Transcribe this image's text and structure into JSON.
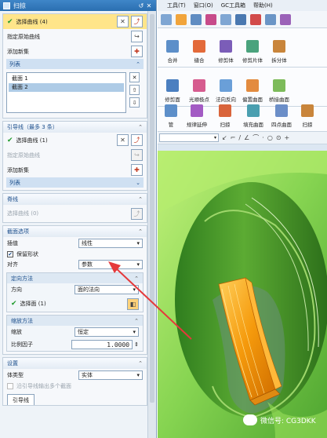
{
  "dialog": {
    "title": "扫掠",
    "section_curves": {
      "select_curve": "选择曲线 (4)",
      "origin_curve": "指定原始曲线",
      "add_new_set": "添加新集",
      "list_label": "列表",
      "list_items": [
        "截面 1",
        "截面 2"
      ]
    },
    "guides": {
      "title": "引导线（最多 3 条）",
      "select_curve": "选择曲线 (1)",
      "origin_curve": "指定原始曲线",
      "add_new_set": "添加新集",
      "list_label": "列表"
    },
    "spine": {
      "title": "脊线",
      "select_curve": "选择曲线 (0)"
    },
    "section_options": {
      "title": "截面选项",
      "interp_label": "插值",
      "interp_value": "线性",
      "preserve_shape": "保留形状",
      "align_label": "对齐",
      "align_value": "参数",
      "orientation": {
        "title": "定向方法",
        "direction_label": "方向",
        "direction_value": "面的法向",
        "select_face": "选择面 (1)"
      },
      "scaling": {
        "title": "缩放方法",
        "scale_label": "缩放",
        "scale_value": "恒定",
        "ratio_label": "比例因子",
        "ratio_value": "1.0000"
      }
    },
    "settings": {
      "title": "设置",
      "body_type_label": "体类型",
      "body_type_value": "实体",
      "guide_output_label": "沿引导线输出多个截面",
      "tab_label": "引导线"
    }
  },
  "app": {
    "menu": [
      "工具(T)",
      "窗口(O)",
      "GC工具箱",
      "帮助(H)"
    ],
    "ribbon_row1": [
      "合并",
      "缝合",
      "修剪体",
      "修剪片体",
      "拆分体"
    ],
    "ribbon_row2": [
      "修剪面",
      "光顺极点",
      "法向反向",
      "偏置曲面",
      "桥接曲面"
    ],
    "ribbon_row3": [
      "管",
      "规律延伸",
      "扫掠",
      "填充曲面",
      "四点曲面",
      "扫掠"
    ]
  },
  "watermark": "微信号: CG3DKK",
  "colors": {
    "title_bar": "#2b6fb1",
    "selected_row": "#ffe58a",
    "section_text": "#1d4f8c",
    "model_green": "#7bd24f",
    "model_orange": "#f59a0c",
    "arrow_red": "#e5393b"
  }
}
